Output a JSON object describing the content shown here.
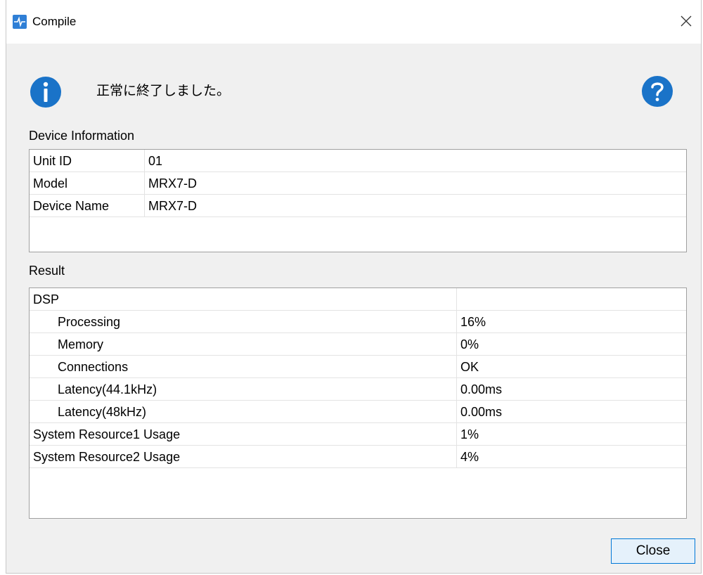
{
  "window": {
    "title": "Compile",
    "app_icon": "app-logo-icon",
    "close_icon": "close-icon"
  },
  "status": {
    "icon": "info-icon",
    "message": "正常に終了しました。",
    "help_icon": "help-icon"
  },
  "device_information": {
    "label": "Device Information",
    "rows": [
      {
        "name": "Unit ID",
        "value": "01"
      },
      {
        "name": "Model",
        "value": "MRX7-D"
      },
      {
        "name": "Device Name",
        "value": "MRX7-D"
      }
    ]
  },
  "result": {
    "label": "Result",
    "rows": [
      {
        "name": "DSP",
        "value": ""
      },
      {
        "name": "Processing",
        "value": "16%"
      },
      {
        "name": "Memory",
        "value": "0%"
      },
      {
        "name": "Connections",
        "value": "OK"
      },
      {
        "name": "Latency(44.1kHz)",
        "value": "0.00ms"
      },
      {
        "name": "Latency(48kHz)",
        "value": "0.00ms"
      },
      {
        "name": "System Resource1 Usage",
        "value": "1%"
      },
      {
        "name": "System Resource2 Usage",
        "value": "4%"
      }
    ]
  },
  "buttons": {
    "close": "Close"
  },
  "colors": {
    "accent": "#0078d7",
    "icon_blue": "#1a73c8",
    "window_bg": "#f0f0f0"
  }
}
